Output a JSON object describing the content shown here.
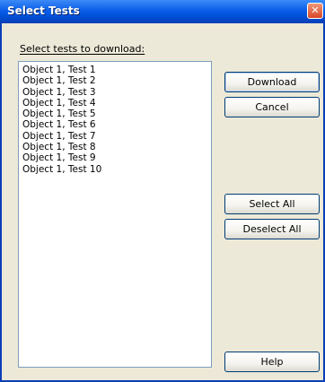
{
  "window": {
    "title": "Select Tests",
    "close_glyph": "✕"
  },
  "prompt": "Select tests to download:",
  "tests": [
    "Object 1, Test 1",
    "Object 1, Test 2",
    "Object 1, Test 3",
    "Object 1, Test 4",
    "Object 1, Test 5",
    "Object 1, Test 6",
    "Object 1, Test 7",
    "Object 1, Test 8",
    "Object 1, Test 9",
    "Object 1, Test 10"
  ],
  "buttons": {
    "download": "Download",
    "cancel": "Cancel",
    "select_all": "Select All",
    "deselect_all": "Deselect All",
    "help": "Help"
  },
  "colors": {
    "title_bar": "#0a5ee8",
    "dialog_bg": "#ece9d8",
    "close_button": "#d9462a"
  }
}
